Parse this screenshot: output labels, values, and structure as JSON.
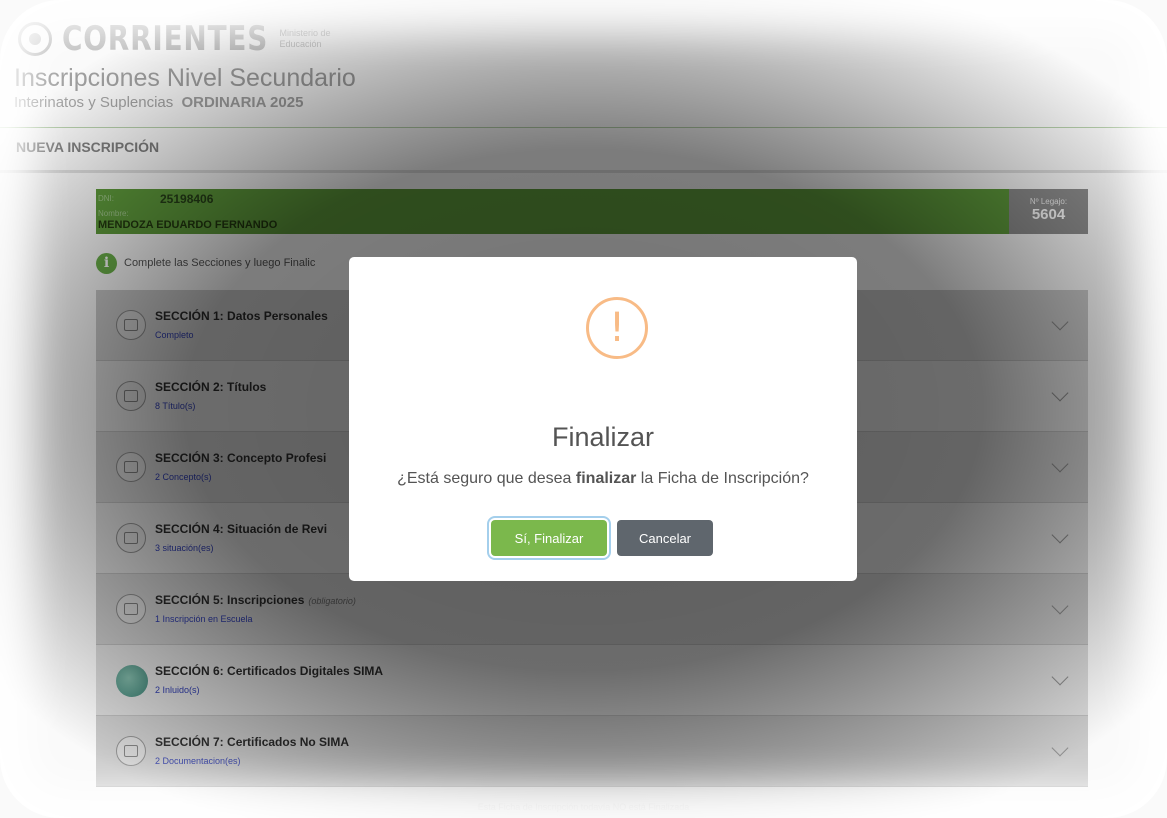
{
  "brand": {
    "name": "CORRIENTES",
    "sub_line1": "Ministerio de",
    "sub_line2": "Educación"
  },
  "app": {
    "title": "Inscripciones Nivel Secundario",
    "subtitle": "Interinatos y Suplencias",
    "edition": "ORDINARIA  2025"
  },
  "page_heading": "NUEVA INSCRIPCIÓN",
  "person": {
    "dni_label": "DNI:",
    "dni": "25198406",
    "name_label": "Nombre:",
    "name": "MENDOZA EDUARDO FERNANDO",
    "legajo_label": "Nº Legajo:",
    "legajo": "5604"
  },
  "info": {
    "icon": "info-icon",
    "text": "Complete las Secciones y luego Finalic"
  },
  "sections": [
    {
      "prefix": "SECCIÓN 1:",
      "title": "Datos Personales",
      "required": "",
      "status": "Completo",
      "icon": "id-card-icon"
    },
    {
      "prefix": "SECCIÓN 2:",
      "title": "Títulos",
      "required": "",
      "status": "8 Título(s)",
      "icon": "diploma-icon"
    },
    {
      "prefix": "SECCIÓN 3:",
      "title": "Concepto Profesi",
      "required": "",
      "status": "2 Concepto(s)",
      "icon": "concept-icon"
    },
    {
      "prefix": "SECCIÓN 4:",
      "title": "Situación de Revi",
      "required": "",
      "status": "3 situación(es)",
      "icon": "document-icon"
    },
    {
      "prefix": "SECCIÓN 5:",
      "title": "Inscripciones",
      "required": "(obligatorio)",
      "status": "1 Inscripción en Escuela",
      "icon": "edit-icon"
    },
    {
      "prefix": "SECCIÓN 6:",
      "title": "Certificados Digitales SIMA",
      "required": "",
      "status": "2 Inluido(s)",
      "icon": "globe-icon"
    },
    {
      "prefix": "SECCIÓN 7:",
      "title": "Certificados No SIMA",
      "required": "",
      "status": "2 Documentacion(es)",
      "icon": "document-icon"
    }
  ],
  "footer_note": "Esta Ficha de Inscripción todavía NO está Finalizada",
  "modal": {
    "icon": "warning-icon",
    "icon_glyph": "!",
    "title": "Finalizar",
    "text_before": "¿Está seguro que desea ",
    "text_bold": "finalizar",
    "text_after": " la Ficha de Inscripción?",
    "confirm_label": "Sí, Finalizar",
    "cancel_label": "Cancelar",
    "colors": {
      "confirm": "#7bb84c",
      "cancel": "#5f666d",
      "warning": "#f8bb86"
    }
  }
}
